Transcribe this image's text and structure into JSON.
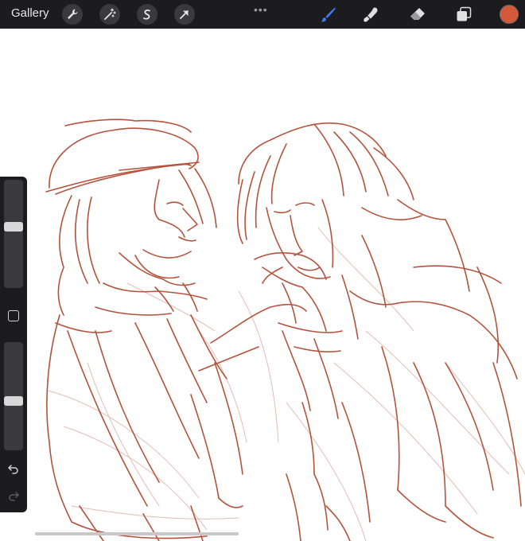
{
  "topbar": {
    "gallery_label": "Gallery",
    "left_tools": [
      {
        "name": "wrench-icon"
      },
      {
        "name": "magic-wand-icon"
      },
      {
        "name": "selection-icon"
      },
      {
        "name": "transform-arrow-icon"
      }
    ],
    "more_menu_label": "•••",
    "right_tools": [
      {
        "name": "brush-icon",
        "active": true
      },
      {
        "name": "smudge-icon",
        "active": false
      },
      {
        "name": "eraser-icon",
        "active": false
      },
      {
        "name": "layers-icon",
        "active": false
      }
    ],
    "current_color": "#d4593a"
  },
  "sidebar": {
    "brush_size_level": 0.57,
    "opacity_level": 0.45
  },
  "colors": {
    "ui_dark": "#1c1c1e",
    "ui_button": "#3a3a3c",
    "active_tool": "#3e7bf6",
    "sketch_stroke": "#b4533d",
    "sketch_light": "#d9a899"
  }
}
